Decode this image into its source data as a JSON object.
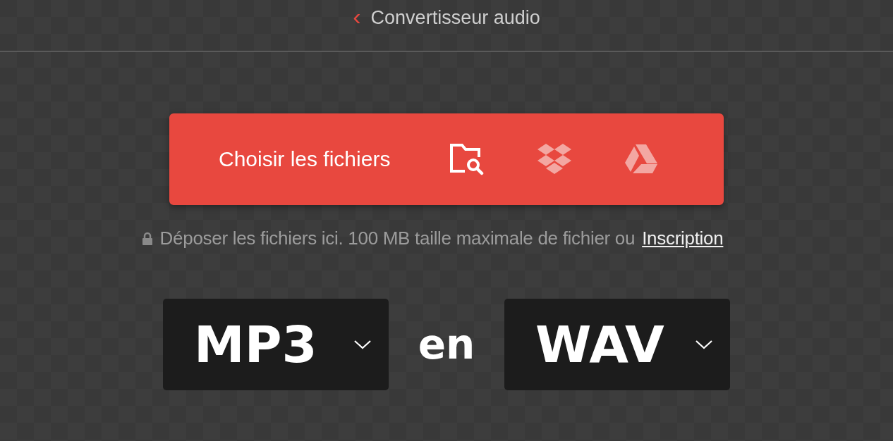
{
  "header": {
    "back": "‹",
    "title": "Convertisseur audio"
  },
  "upload": {
    "label": "Choisir les fichiers"
  },
  "note": {
    "text": "Déposer les fichiers ici. 100 MB taille maximale de fichier ou",
    "link": "Inscription"
  },
  "converter": {
    "from": "MP3",
    "separator": "en",
    "to": "WAV"
  }
}
